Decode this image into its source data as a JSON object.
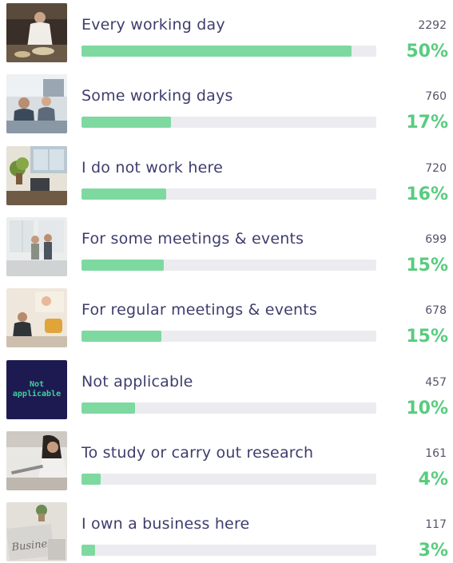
{
  "chart_data": {
    "type": "bar",
    "orientation": "horizontal",
    "max": 2292,
    "items": [
      {
        "label": "Every working day",
        "count": "2292",
        "percent": "50%",
        "value": 2292,
        "thumb": "restaurant-worker-photo",
        "thumb_text": ""
      },
      {
        "label": "Some working days",
        "count": "760",
        "percent": "17%",
        "value": 760,
        "thumb": "office-desk-photo",
        "thumb_text": ""
      },
      {
        "label": "I do not work here",
        "count": "720",
        "percent": "16%",
        "value": 720,
        "thumb": "office-plant-photo",
        "thumb_text": ""
      },
      {
        "label": "For some meetings & events",
        "count": "699",
        "percent": "15%",
        "value": 699,
        "thumb": "meeting-room-photo",
        "thumb_text": ""
      },
      {
        "label": "For regular meetings & events",
        "count": "678",
        "percent": "15%",
        "value": 678,
        "thumb": "lounge-photo",
        "thumb_text": ""
      },
      {
        "label": "Not applicable",
        "count": "457",
        "percent": "10%",
        "value": 457,
        "thumb": "not-applicable-tile",
        "thumb_text": "Not\napplicable"
      },
      {
        "label": "To study or carry out research",
        "count": "161",
        "percent": "4%",
        "value": 161,
        "thumb": "laptop-study-photo",
        "thumb_text": ""
      },
      {
        "label": "I own a business here",
        "count": "117",
        "percent": "3%",
        "value": 117,
        "thumb": "newspaper-business-photo",
        "thumb_text": ""
      }
    ]
  },
  "colors": {
    "label": "#3e3d6e",
    "bar": "#7ed9a1",
    "track": "#ececf0",
    "percent": "#58cc7f",
    "count": "#55546a"
  }
}
